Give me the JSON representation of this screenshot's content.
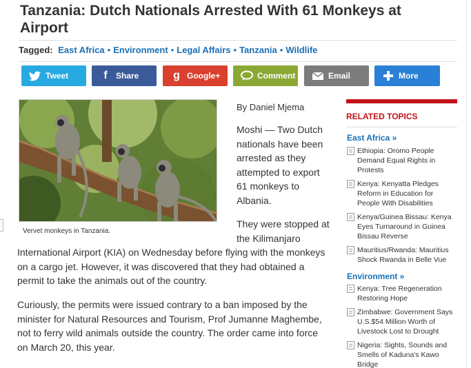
{
  "article": {
    "title": "Tanzania: Dutch Nationals Arrested With 61 Monkeys at Airport",
    "byline": "By Daniel Mjema",
    "caption": "Vervet monkeys in Tanzania.",
    "p1": "Moshi — Two Dutch nationals have been arrested as they attempted to export 61 monkeys to Albania.",
    "p2_start": "They were stopped at the Kilimanjaro",
    "p2_rest": "International Airport (KIA) on Wednesday before flying with the monkeys on a cargo jet. However, it was discovered that they had obtained a permit to take the animals out of the country.",
    "p3": "Curiously, the permits were issued contrary to a ban imposed by the minister for Natural Resources and Tourism, Prof Jumanne Maghembe, not to ferry wild animals outside the country. The order came into force on March 20, this year."
  },
  "tags": {
    "label": "Tagged:",
    "items": [
      "East Africa",
      "Environment",
      "Legal Affairs",
      "Tanzania",
      "Wildlife"
    ]
  },
  "share": {
    "tweet": "Tweet",
    "share": "Share",
    "google": "Google+",
    "comment": "Comment",
    "email": "Email",
    "more": "More"
  },
  "sidebar": {
    "heading": "RELATED TOPICS",
    "sections": [
      {
        "title": "East Africa »",
        "items": [
          "Ethiopia: Oromo People Demand Equal Rights in Protests",
          "Kenya: Kenyatta Pledges Reform in Education for People With Disabilities",
          "Kenya/Guinea Bissau: Kenya Eyes Turnaround in Guinea Bissau Reverse",
          "Mauritius/Rwanda: Mauritius Shock Rwanda in Belle Vue"
        ]
      },
      {
        "title": "Environment »",
        "items": [
          "Kenya: Tree Regeneration Restoring Hope",
          "Zimbabwe: Government Says U.S.$54 Million Worth of Livestock Lost to Drought",
          "Nigeria: Sights, Sounds and Smells of Kaduna's Kawo Bridge"
        ]
      }
    ]
  },
  "colors": {
    "link": "#1a6fb5",
    "accent_red": "#c4121a",
    "twitter": "#27a9e1",
    "facebook": "#3b5a9a",
    "google": "#d9402d",
    "comment": "#8ba834",
    "email": "#7c7c7c",
    "more": "#2a7fd6"
  }
}
